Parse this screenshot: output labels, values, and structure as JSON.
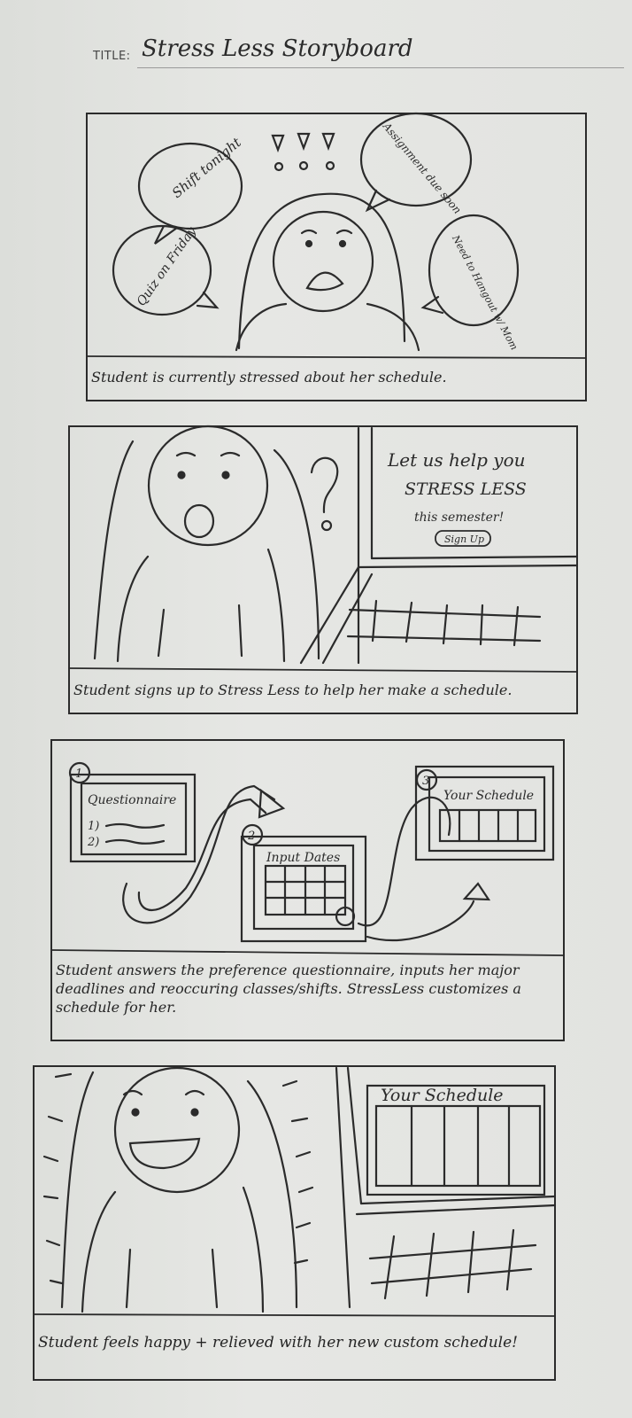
{
  "title": {
    "label": "TITLE:",
    "value": "Stress Less Storyboard"
  },
  "panels": [
    {
      "caption": "Student is currently stressed about her schedule.",
      "bubbles": [
        "Shift tonight",
        "Assignment due soon",
        "Quiz on Friday",
        "Need to Hangout w/ Mom"
      ]
    },
    {
      "caption": "Student signs up to Stress Less to help her make a schedule.",
      "screen_lines": [
        "Let us help you",
        "STRESS LESS",
        "this semester!"
      ],
      "button": "Sign Up"
    },
    {
      "caption": "Student answers the preference questionnaire, inputs her major deadlines and reoccuring classes/shifts. StressLess customizes a schedule for her.",
      "steps": [
        {
          "number": "1",
          "label": "Questionnaire",
          "items": [
            "1)",
            "2)"
          ]
        },
        {
          "number": "2",
          "label": "Input Dates"
        },
        {
          "number": "3",
          "label": "Your Schedule"
        }
      ]
    },
    {
      "caption": "Student feels happy + relieved with her new custom schedule!",
      "screen_title": "Your Schedule"
    }
  ]
}
